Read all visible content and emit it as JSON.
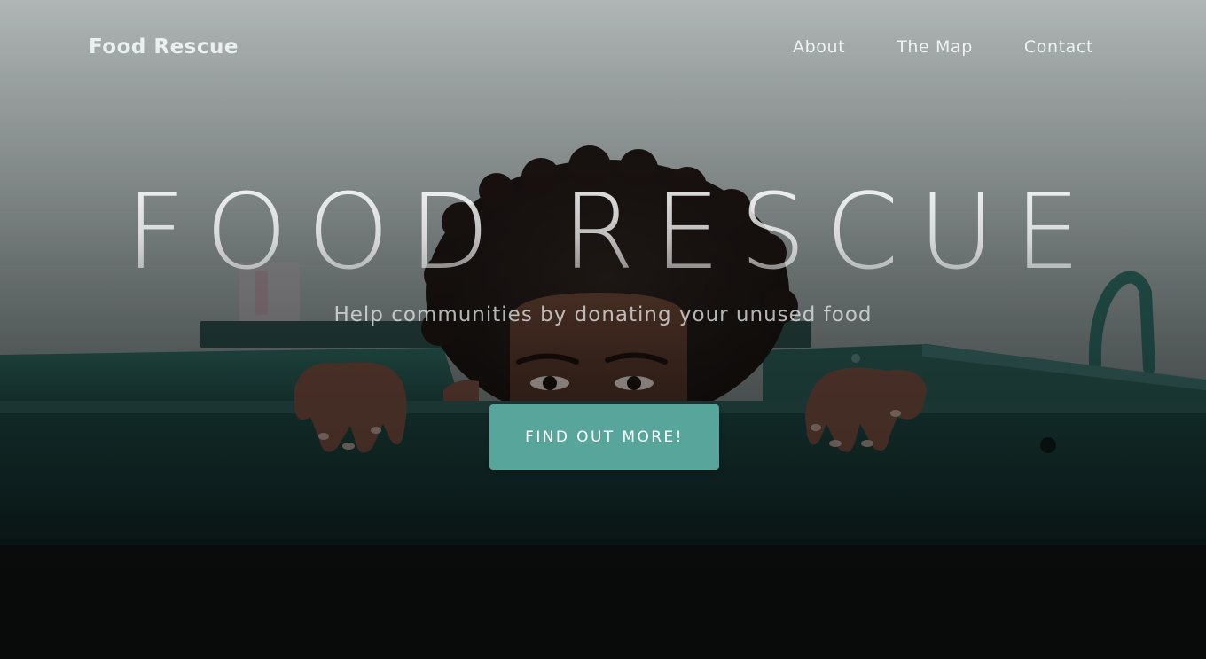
{
  "navbar": {
    "brand": "Food Rescue",
    "links": [
      {
        "label": "About"
      },
      {
        "label": "The Map"
      },
      {
        "label": "Contact"
      }
    ]
  },
  "hero": {
    "title": "FOOD RESCUE",
    "subtitle": "Help communities by donating your unused food",
    "cta_label": "FIND OUT MORE!",
    "background_image": "person-peeking-over-green-dumpster",
    "overlay": "dark-gradient"
  },
  "colors": {
    "accent": "#58a59c",
    "wall": "#bfc6c6",
    "dumpster": "#1f4a45",
    "ground": "#141818"
  }
}
